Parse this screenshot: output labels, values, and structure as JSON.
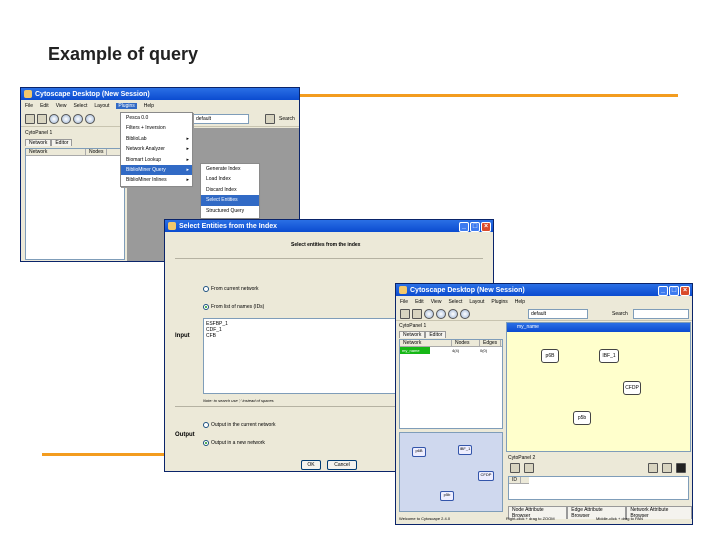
{
  "slide": {
    "title": "Example of query"
  },
  "back_window": {
    "title": "Cytoscape Desktop (New Session)",
    "menu": [
      "File",
      "Edit",
      "View",
      "Select",
      "Layout",
      "Plugins",
      "Help"
    ],
    "selected_menu": "Plugins",
    "combo_value": "default",
    "search_label": "Search",
    "cytopanel_title": "CytoPanel 1",
    "tabs": [
      "Network",
      "Editor"
    ],
    "columns": [
      "Network",
      "Nodes"
    ]
  },
  "plugins_menu": {
    "items": [
      {
        "label": "Pesca 0.0",
        "arrow": false
      },
      {
        "label": "Filters + Inversion",
        "arrow": false
      },
      {
        "label": "BiblioLab",
        "arrow": true
      },
      {
        "label": "Network Analyzer",
        "arrow": true
      },
      {
        "label": "Biomart Lookup",
        "arrow": true
      },
      {
        "label": "BiblioMiner Query",
        "arrow": true
      },
      {
        "label": "BiblioMiner Inlines",
        "arrow": true
      }
    ],
    "selected_index": 5
  },
  "sub_menu": {
    "items": [
      "Generate Index",
      "Load Index",
      "Discard Index",
      "Select Entities",
      "Structured Query"
    ],
    "selected_index": 3
  },
  "dialog": {
    "title": "Select Entities from the Index",
    "heading": "Select entities from the index",
    "input_label": "Input",
    "output_label": "Output",
    "radio_current": "From current network",
    "radio_list": "From list of names (IDs)",
    "names_text": "ESFBP_1\nCDF_1\nCFB",
    "note": "Note: to search use ';' instead of spaces",
    "out_current": "Output in the current network",
    "out_new": "Output in a new network",
    "ok_label": "OK",
    "cancel_label": "Cancel"
  },
  "front_window": {
    "title": "Cytoscape Desktop (New Session)",
    "menu": [
      "File",
      "Edit",
      "View",
      "Select",
      "Layout",
      "Plugins",
      "Help"
    ],
    "combo_value": "default",
    "search_label": "Search",
    "cytopanel_title": "CytoPanel 1",
    "tabs": [
      "Network",
      "Editor"
    ],
    "columns": [
      "Network",
      "Nodes",
      "Edges"
    ],
    "network_row": {
      "name": "my_name",
      "nodes": "4(4)",
      "edges": "0(0)"
    },
    "network_title": "my_name",
    "nodes": [
      {
        "label": "p6B"
      },
      {
        "label": "IBF_1"
      },
      {
        "label": "CFDP"
      },
      {
        "label": "p5b"
      }
    ],
    "mini_nodes": [
      "p6B",
      "IBF_1",
      "CFDP",
      "p5b"
    ],
    "cytopanel2_title": "CytoPanel 2",
    "bottom_tabs": [
      "Node Attribute Browser",
      "Edge Attribute Browser",
      "Network Attribute Browser"
    ],
    "status_left": "Welcome to Cytoscape 2.4.0",
    "status_mid": "Right-click + drag to ZOOM",
    "status_right": "Middle-click + drag to PAN"
  },
  "colors": {
    "accent_line": "#f39c1f",
    "title_bar": "#0b4bd0",
    "canvas": "#ffffcc",
    "selected_row": "#16b716"
  }
}
